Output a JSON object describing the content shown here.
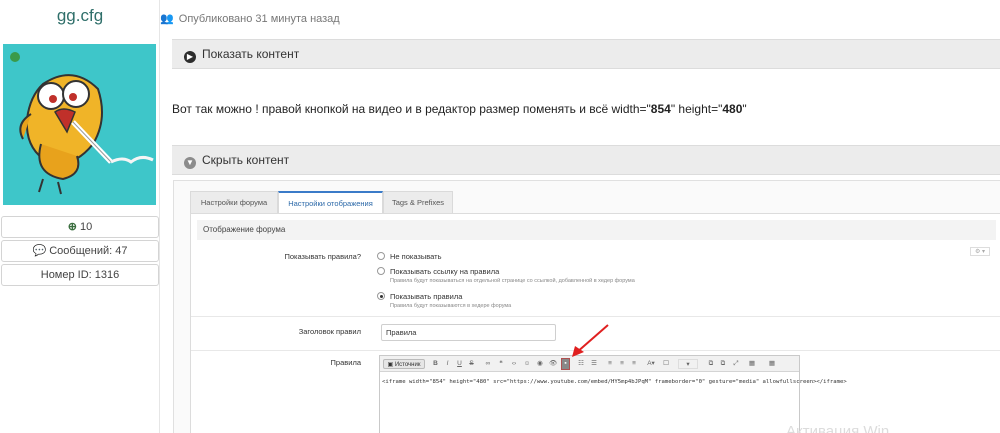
{
  "profile": {
    "username": "gg.cfg",
    "reputation": "10",
    "messages": "Сообщений: 47",
    "member_id": "Номер ID: 1316"
  },
  "post": {
    "meta": "Опубликовано 31 минута назад",
    "show_spoiler": "Показать контент",
    "text_before": "Вот так можно ! правой кнопкой на видео и в редактор размер поменять и всё width=\"",
    "width_value": "854",
    "text_middle": "\" height=\"",
    "height_value": "480",
    "text_after": "\"",
    "hide_spoiler": "Скрыть контент"
  },
  "admin": {
    "tabs": [
      "Настройки форума",
      "Настройки отображения",
      "Tags & Prefixes"
    ],
    "active_tab": 1,
    "panel_title": "Отображение форума",
    "rules_label": "Показывать правила?",
    "options": [
      {
        "label": "Не показывать",
        "hint": "",
        "selected": false
      },
      {
        "label": "Показывать ссылку на правила",
        "hint": "Правила будут показываться на отдельной странице со ссылкой, добавленной в хедер форума",
        "selected": false
      },
      {
        "label": "Показывать правила",
        "hint": "Правила будут показываются в хедере форума",
        "selected": true
      }
    ],
    "gear_text": "⚙ ▾",
    "rules_title_label": "Заголовок правил",
    "rules_title_value": "Правила",
    "rules_label2": "Правила",
    "source_button": "Источник",
    "code": "<iframe width=\"854\" height=\"480\" src=\"https://www.youtube.com/embed/HY5mp4bJPqM\" frameborder=\"0\" gesture=\"media\" allowfullscreen></iframe>",
    "watermark": "Активация Win"
  },
  "colors": {
    "accent": "#2f6f6a",
    "annotation_arrow": "#e02020",
    "avatar_bg": "#3ec6c9",
    "online": "#3a9a4a"
  }
}
